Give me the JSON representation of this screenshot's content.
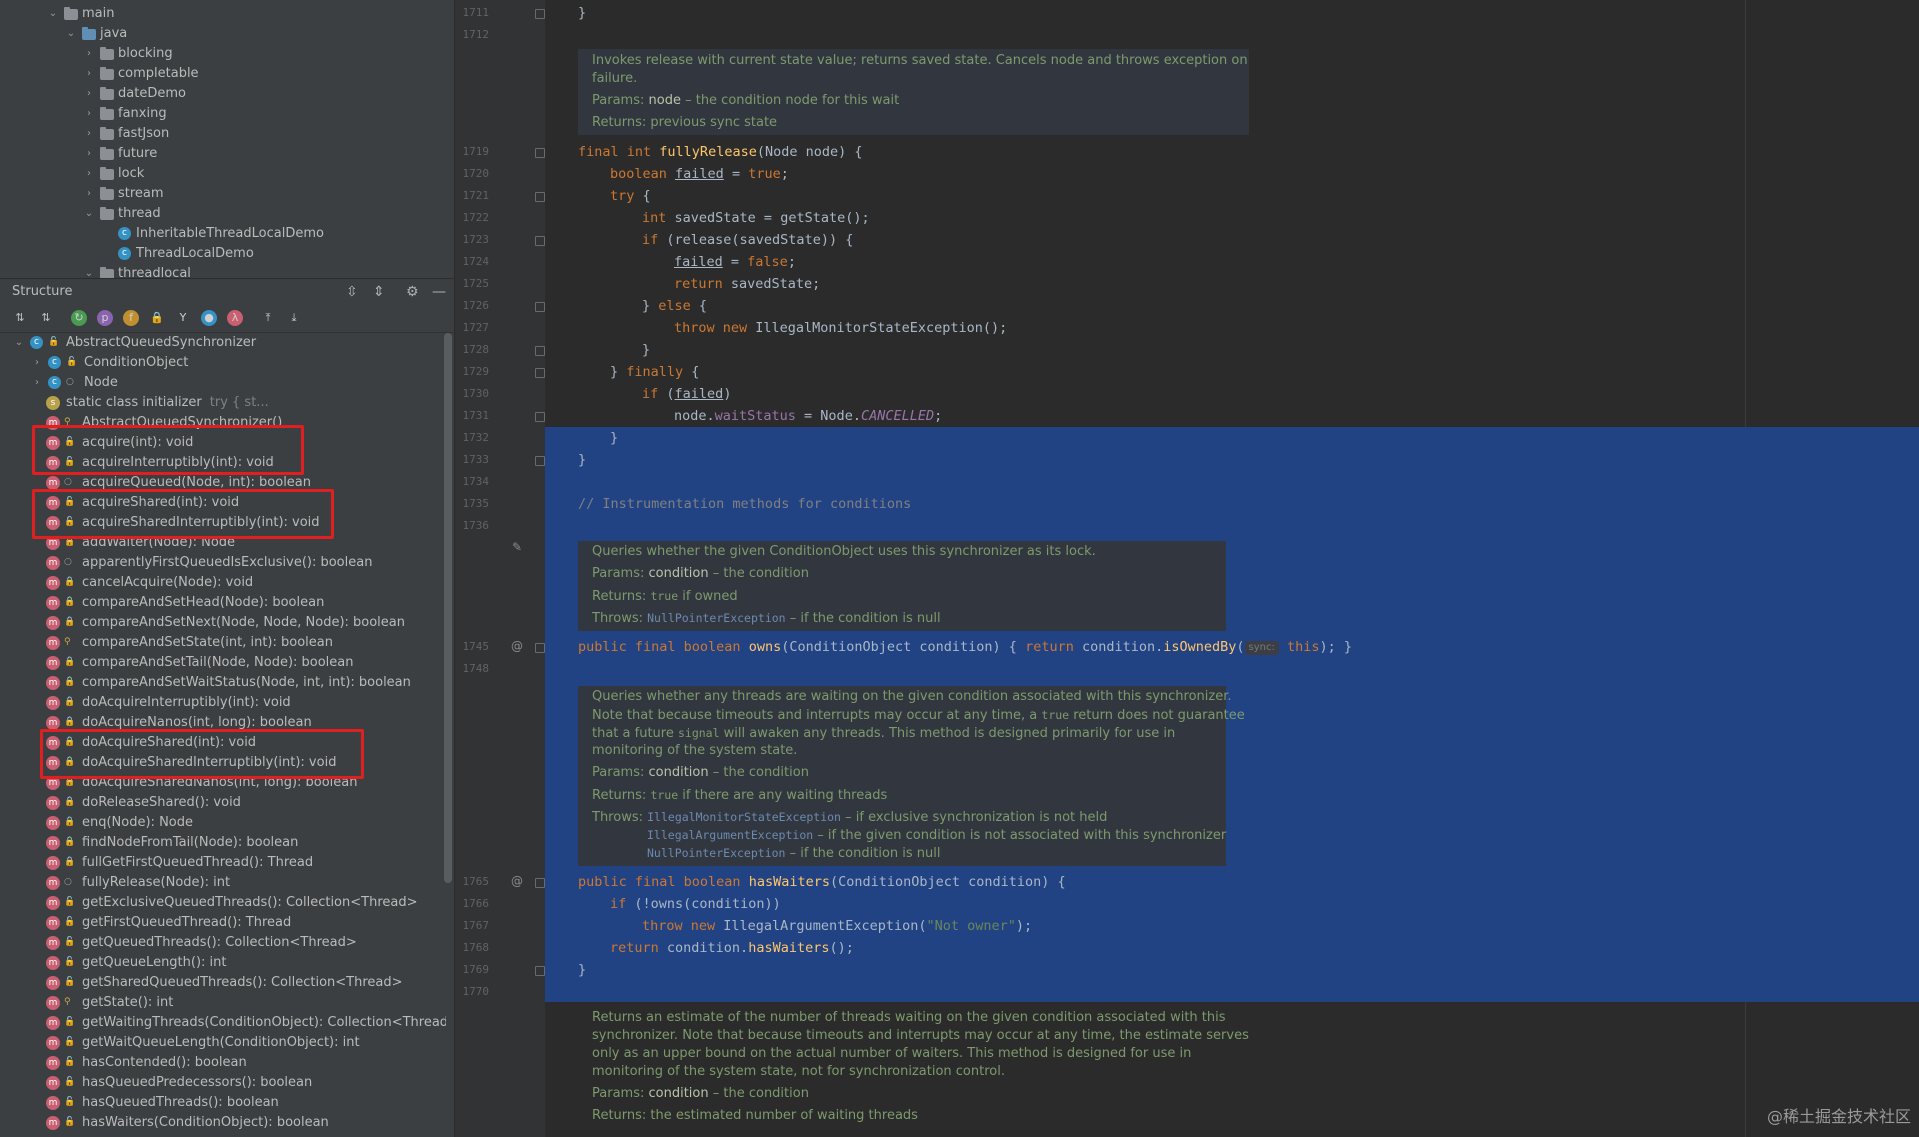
{
  "project_tree": [
    {
      "label": "main",
      "indent": 0,
      "arrow": "down",
      "icon": "folder"
    },
    {
      "label": "java",
      "indent": 1,
      "arrow": "down",
      "icon": "folder-blue"
    },
    {
      "label": "blocking",
      "indent": 2,
      "arrow": "right",
      "icon": "package"
    },
    {
      "label": "completable",
      "indent": 2,
      "arrow": "right",
      "icon": "package"
    },
    {
      "label": "dateDemo",
      "indent": 2,
      "arrow": "right",
      "icon": "package"
    },
    {
      "label": "fanxing",
      "indent": 2,
      "arrow": "right",
      "icon": "package"
    },
    {
      "label": "fastJson",
      "indent": 2,
      "arrow": "right",
      "icon": "package"
    },
    {
      "label": "future",
      "indent": 2,
      "arrow": "right",
      "icon": "package"
    },
    {
      "label": "lock",
      "indent": 2,
      "arrow": "right",
      "icon": "package"
    },
    {
      "label": "stream",
      "indent": 2,
      "arrow": "right",
      "icon": "package"
    },
    {
      "label": "thread",
      "indent": 2,
      "arrow": "down",
      "icon": "package"
    },
    {
      "label": "InheritableThreadLocalDemo",
      "indent": 3,
      "arrow": "",
      "icon": "class"
    },
    {
      "label": "ThreadLocalDemo",
      "indent": 3,
      "arrow": "",
      "icon": "class"
    },
    {
      "label": "threadlocal",
      "indent": 2,
      "arrow": "down",
      "icon": "package"
    }
  ],
  "structure": {
    "title": "Structure",
    "items": [
      {
        "label": "AbstractQueuedSynchronizer",
        "hint": "",
        "depth": 0,
        "arrow": "down",
        "badge": "class",
        "vis": "pub"
      },
      {
        "label": "ConditionObject",
        "hint": "",
        "depth": 1,
        "arrow": "right",
        "badge": "class",
        "vis": "pub"
      },
      {
        "label": "Node",
        "hint": "",
        "depth": 1,
        "arrow": "right",
        "badge": "class",
        "vis": "pkg"
      },
      {
        "label": "static class initializer",
        "hint": "try {          st...",
        "depth": 1,
        "arrow": "",
        "badge": "static",
        "vis": ""
      },
      {
        "label": "AbstractQueuedSynchronizer()",
        "hint": "",
        "depth": 1,
        "arrow": "",
        "badge": "m",
        "vis": "pro"
      },
      {
        "label": "acquire(int): void",
        "hint": "",
        "depth": 1,
        "arrow": "",
        "badge": "m",
        "vis": "pub"
      },
      {
        "label": "acquireInterruptibly(int): void",
        "hint": "",
        "depth": 1,
        "arrow": "",
        "badge": "m",
        "vis": "pub"
      },
      {
        "label": "acquireQueued(Node, int): boolean",
        "hint": "",
        "depth": 1,
        "arrow": "",
        "badge": "m",
        "vis": "pkg"
      },
      {
        "label": "acquireShared(int): void",
        "hint": "",
        "depth": 1,
        "arrow": "",
        "badge": "m",
        "vis": "pub"
      },
      {
        "label": "acquireSharedInterruptibly(int): void",
        "hint": "",
        "depth": 1,
        "arrow": "",
        "badge": "m",
        "vis": "pub"
      },
      {
        "label": "addWaiter(Node): Node",
        "hint": "",
        "depth": 1,
        "arrow": "",
        "badge": "m",
        "vis": "pri"
      },
      {
        "label": "apparentlyFirstQueuedIsExclusive(): boolean",
        "hint": "",
        "depth": 1,
        "arrow": "",
        "badge": "m",
        "vis": "pkg"
      },
      {
        "label": "cancelAcquire(Node): void",
        "hint": "",
        "depth": 1,
        "arrow": "",
        "badge": "m",
        "vis": "pri"
      },
      {
        "label": "compareAndSetHead(Node): boolean",
        "hint": "",
        "depth": 1,
        "arrow": "",
        "badge": "m",
        "vis": "pri"
      },
      {
        "label": "compareAndSetNext(Node, Node, Node): boolean",
        "hint": "",
        "depth": 1,
        "arrow": "",
        "badge": "m",
        "vis": "pri"
      },
      {
        "label": "compareAndSetState(int, int): boolean",
        "hint": "",
        "depth": 1,
        "arrow": "",
        "badge": "m",
        "vis": "pro"
      },
      {
        "label": "compareAndSetTail(Node, Node): boolean",
        "hint": "",
        "depth": 1,
        "arrow": "",
        "badge": "m",
        "vis": "pri"
      },
      {
        "label": "compareAndSetWaitStatus(Node, int, int): boolean",
        "hint": "",
        "depth": 1,
        "arrow": "",
        "badge": "m",
        "vis": "pri"
      },
      {
        "label": "doAcquireInterruptibly(int): void",
        "hint": "",
        "depth": 1,
        "arrow": "",
        "badge": "m",
        "vis": "pri"
      },
      {
        "label": "doAcquireNanos(int, long): boolean",
        "hint": "",
        "depth": 1,
        "arrow": "",
        "badge": "m",
        "vis": "pri"
      },
      {
        "label": "doAcquireShared(int): void",
        "hint": "",
        "depth": 1,
        "arrow": "",
        "badge": "m",
        "vis": "pri"
      },
      {
        "label": "doAcquireSharedInterruptibly(int): void",
        "hint": "",
        "depth": 1,
        "arrow": "",
        "badge": "m",
        "vis": "pri"
      },
      {
        "label": "doAcquireSharedNanos(int, long): boolean",
        "hint": "",
        "depth": 1,
        "arrow": "",
        "badge": "m",
        "vis": "pri"
      },
      {
        "label": "doReleaseShared(): void",
        "hint": "",
        "depth": 1,
        "arrow": "",
        "badge": "m",
        "vis": "pri"
      },
      {
        "label": "enq(Node): Node",
        "hint": "",
        "depth": 1,
        "arrow": "",
        "badge": "m",
        "vis": "pri"
      },
      {
        "label": "findNodeFromTail(Node): boolean",
        "hint": "",
        "depth": 1,
        "arrow": "",
        "badge": "m",
        "vis": "pri"
      },
      {
        "label": "fullGetFirstQueuedThread(): Thread",
        "hint": "",
        "depth": 1,
        "arrow": "",
        "badge": "m",
        "vis": "pri"
      },
      {
        "label": "fullyRelease(Node): int",
        "hint": "",
        "depth": 1,
        "arrow": "",
        "badge": "m",
        "vis": "pkg"
      },
      {
        "label": "getExclusiveQueuedThreads(): Collection<Thread>",
        "hint": "",
        "depth": 1,
        "arrow": "",
        "badge": "m",
        "vis": "pub"
      },
      {
        "label": "getFirstQueuedThread(): Thread",
        "hint": "",
        "depth": 1,
        "arrow": "",
        "badge": "m",
        "vis": "pub"
      },
      {
        "label": "getQueuedThreads(): Collection<Thread>",
        "hint": "",
        "depth": 1,
        "arrow": "",
        "badge": "m",
        "vis": "pub"
      },
      {
        "label": "getQueueLength(): int",
        "hint": "",
        "depth": 1,
        "arrow": "",
        "badge": "m",
        "vis": "pub"
      },
      {
        "label": "getSharedQueuedThreads(): Collection<Thread>",
        "hint": "",
        "depth": 1,
        "arrow": "",
        "badge": "m",
        "vis": "pub"
      },
      {
        "label": "getState(): int",
        "hint": "",
        "depth": 1,
        "arrow": "",
        "badge": "m",
        "vis": "pro"
      },
      {
        "label": "getWaitingThreads(ConditionObject): Collection<Thread>",
        "hint": "",
        "depth": 1,
        "arrow": "",
        "badge": "m",
        "vis": "pub"
      },
      {
        "label": "getWaitQueueLength(ConditionObject): int",
        "hint": "",
        "depth": 1,
        "arrow": "",
        "badge": "m",
        "vis": "pub"
      },
      {
        "label": "hasContended(): boolean",
        "hint": "",
        "depth": 1,
        "arrow": "",
        "badge": "m",
        "vis": "pub"
      },
      {
        "label": "hasQueuedPredecessors(): boolean",
        "hint": "",
        "depth": 1,
        "arrow": "",
        "badge": "m",
        "vis": "pub"
      },
      {
        "label": "hasQueuedThreads(): boolean",
        "hint": "",
        "depth": 1,
        "arrow": "",
        "badge": "m",
        "vis": "pub"
      },
      {
        "label": "hasWaiters(ConditionObject): boolean",
        "hint": "",
        "depth": 1,
        "arrow": "",
        "badge": "m",
        "vis": "pub"
      }
    ],
    "highlighted": [
      "acquire(int): void",
      "acquireInterruptibly(int): void",
      "acquireShared(int): void",
      "acquireSharedInterruptibly(int): void",
      "doAcquireShared(int): void",
      "doAcquireSharedInterruptibly(int): void"
    ]
  },
  "gutter": {
    "line_numbers": [
      "1711",
      "1712",
      "1719",
      "1720",
      "1721",
      "1722",
      "1723",
      "1724",
      "1725",
      "1726",
      "1727",
      "1728",
      "1729",
      "1730",
      "1731",
      "1732",
      "1733",
      "1734",
      "1735",
      "1736",
      "1745",
      "1748",
      "1765",
      "1766",
      "1767",
      "1768",
      "1769",
      "1770"
    ],
    "override_mark": "@"
  },
  "code": {
    "close_brace": "}",
    "fullyRelease": {
      "sig_kw": "final int",
      "sig_name": "fullyRelease",
      "sig_params": "(Node node) {",
      "l1_kw": "boolean",
      "l1_var": "failed",
      "l1_rest": " = ",
      "l1_val": "true",
      "try_kw": "try",
      "try_rest": " {",
      "l3_kw": "int",
      "l3_mid": " savedState = ",
      "l3_call": "getState",
      "l3_end": "();",
      "l4_kw": "if",
      "l4_rest": " (release(savedState)) {",
      "l5_var": "failed",
      "l5_rest": " = ",
      "l5_val": "false",
      "l5_end": ";",
      "l6_kw": "return",
      "l6_rest": " savedState;",
      "else_pre": "} ",
      "else_kw": "else",
      "else_rest": " {",
      "throw_kw": "throw new",
      "throw_rest": " IllegalMonitorStateException();",
      "finally_pre": "} ",
      "finally_kw": "finally",
      "finally_rest": " {",
      "if2_kw": "if",
      "if2_pre": " (",
      "if2_var": "failed",
      "if2_end": ")",
      "l_node": "node.",
      "l_ws": "waitStatus",
      "l_eq": " = Node.",
      "l_cancel": "CANCELLED",
      "l_semi": ";"
    },
    "comment_line": "// Instrumentation methods for conditions",
    "owns": {
      "kw": "public final boolean",
      "name": "owns",
      "params": "(ConditionObject condition) { ",
      "ret": "return",
      "call_pre": " condition.",
      "call": "isOwnedBy",
      "open": "(",
      "inlay": "sync:",
      "this": "this",
      "end": "); }"
    },
    "hasWaiters": {
      "kw": "public final boolean",
      "name": "hasWaiters",
      "params": "(ConditionObject condition) {",
      "if_kw": "if",
      "if_rest": " (!",
      "if_call": "owns",
      "if_end": "(condition))",
      "throw_kw": "throw new",
      "throw_rest": " IllegalArgumentException(",
      "throw_str": "\"Not owner\"",
      "throw_end": ");",
      "ret_kw": "return",
      "ret_pre": " condition.",
      "ret_call": "hasWaiters",
      "ret_end": "();"
    }
  },
  "docs": {
    "d1": {
      "l1": "Invokes release with current state value; returns saved state. Cancels node and throws exception on",
      "l2": "failure.",
      "params_k": "Params:",
      "params_v": "node",
      "params_d": " – the condition node for this wait",
      "returns_k": "Returns:",
      "returns_d": " previous sync state"
    },
    "d2": {
      "l1": "Queries whether the given ConditionObject uses this synchronizer as its lock.",
      "params_k": "Params:",
      "params_v": "condition",
      "params_d": " – the condition",
      "returns_k": "Returns:",
      "returns_c": "true",
      "returns_d": " if owned",
      "throws_k": "Throws:",
      "throws_c": "NullPointerException",
      "throws_d": " – if the condition is null"
    },
    "d3": {
      "l1": "Queries whether any threads are waiting on the given condition associated with this synchronizer.",
      "l2a": "Note that because timeouts and interrupts may occur at any time, a ",
      "l2c": "true",
      "l2b": " return does not guarantee",
      "l3a": "that a future ",
      "l3c": "signal",
      "l3b": " will awaken any threads. This method is designed primarily for use in",
      "l4": "monitoring of the system state.",
      "params_k": "Params:",
      "params_v": "condition",
      "params_d": " – the condition",
      "returns_k": "Returns:",
      "returns_c": "true",
      "returns_d": " if there are any waiting threads",
      "throws_k": "Throws:",
      "t1c": "IllegalMonitorStateException",
      "t1d": " – if exclusive synchronization is not held",
      "t2c": "IllegalArgumentException",
      "t2d": " – if the given condition is not associated with this synchronizer",
      "t3c": "NullPointerException",
      "t3d": " – if the condition is null"
    },
    "d4": {
      "l1": "Returns an estimate of the number of threads waiting on the given condition associated with this",
      "l2": "synchronizer. Note that because timeouts and interrupts may occur at any time, the estimate serves",
      "l3": "only as an upper bound on the actual number of waiters. This method is designed for use in",
      "l4": "monitoring of the system state, not for synchronization control.",
      "params_k": "Params:",
      "params_v": "condition",
      "params_d": " – the condition",
      "returns_k": "Returns:",
      "returns_d": " the estimated number of waiting threads"
    }
  },
  "watermark": "@稀土掘金技术社区",
  "colors": {
    "selection": "#214283",
    "highlight_box": "#e02020",
    "keyword": "#cc7832",
    "function": "#ffc66d"
  }
}
